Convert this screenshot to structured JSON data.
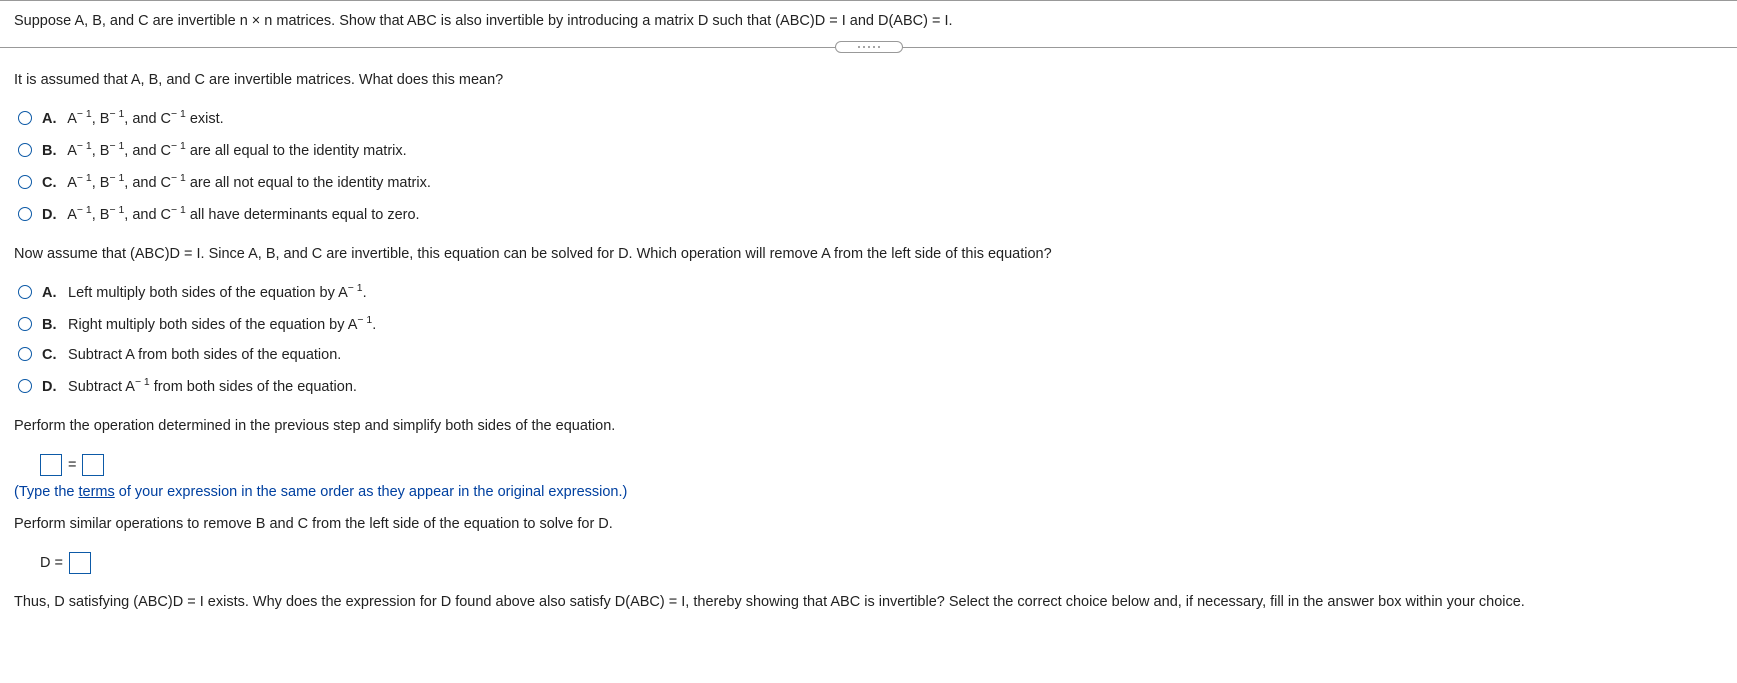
{
  "problem": {
    "statement": "Suppose A, B, and C are invertible n × n matrices. Show that ABC is also invertible by introducing a matrix D such that (ABC)D = I and D(ABC) = I."
  },
  "q1": {
    "prompt": "It is assumed that A, B, and C are invertible matrices. What does this mean?",
    "options": {
      "A": {
        "pre": "A",
        "mid1": ", B",
        "mid2": ", and C",
        "tail": " exist."
      },
      "B": {
        "pre": "A",
        "mid1": ", B",
        "mid2": ", and C",
        "tail": " are all equal to the identity matrix."
      },
      "C": {
        "pre": "A",
        "mid1": ", B",
        "mid2": ", and C",
        "tail": " are all not equal to the identity matrix."
      },
      "D": {
        "pre": "A",
        "mid1": ", B",
        "mid2": ", and C",
        "tail": " all have determinants equal to zero."
      }
    },
    "exp": "− 1"
  },
  "q2": {
    "prompt": "Now assume that (ABC)D = I. Since A, B, and C are invertible, this equation can be solved for D. Which operation will remove A from the left side of this equation?",
    "options": {
      "A": {
        "pre": "Left multiply both sides of the equation by A",
        "tail": "."
      },
      "B": {
        "pre": "Right multiply both sides of the equation by A",
        "tail": "."
      },
      "C": {
        "text": "Subtract A from both sides of the equation."
      },
      "D": {
        "pre": "Subtract A",
        "tail": " from both sides of the equation."
      }
    },
    "exp": "− 1"
  },
  "step3": {
    "prompt": "Perform the operation determined in the previous step and simplify both sides of the equation.",
    "eq_sign": "=",
    "hint": "(Type the terms of your expression in the same order as they appear in the original expression.)"
  },
  "step4": {
    "prompt": "Perform similar operations to remove B and C from the left side of the equation to solve for D.",
    "lhs": "D ="
  },
  "final": {
    "prompt": "Thus, D satisfying (ABC)D = I exists. Why does the expression for D found above also satisfy D(ABC) = I, thereby showing that ABC is invertible? Select the correct choice below and, if necessary, fill in the answer box within your choice."
  },
  "labels": {
    "A": "A.",
    "B": "B.",
    "C": "C.",
    "D": "D."
  }
}
